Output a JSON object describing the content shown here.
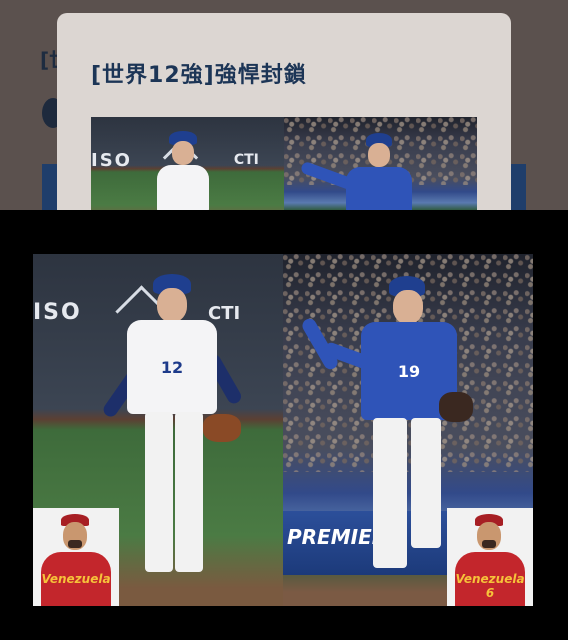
{
  "background": {
    "title_fragment": "[世"
  },
  "modal": {
    "title": "[世界12強]強悍封鎖",
    "thumbnail": {
      "left_sponsor": "ISO",
      "right_sponsor": "CTI"
    }
  },
  "viewer": {
    "left_player": {
      "jersey_number": "12",
      "sponsor_text": "ISO",
      "sponsor_text_2": "CTI"
    },
    "right_player": {
      "jersey_number": "19",
      "banner_text": "PREMIER"
    },
    "inset_left": {
      "jersey_text": "Venezuela"
    },
    "inset_right": {
      "jersey_text": "Venezuela",
      "jersey_number": "6"
    }
  },
  "colors": {
    "modal_bg": "#dcd6d2",
    "title": "#1c3556",
    "team_blue": "#2f54b8",
    "venezuela_red": "#c3262c"
  }
}
